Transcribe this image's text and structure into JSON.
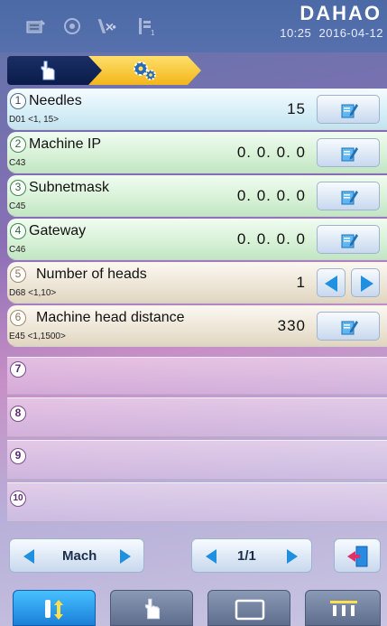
{
  "header": {
    "brand": "DAHAO",
    "time": "10:25",
    "date": "2016-04-12",
    "status_icons": [
      "card-reader-icon",
      "spool-icon",
      "needle-cut-icon",
      "head-count-icon"
    ]
  },
  "tabs": [
    {
      "name": "manual",
      "icon": "hand-pointer-icon"
    },
    {
      "name": "settings",
      "icon": "gears-icon",
      "active": true
    }
  ],
  "params": [
    {
      "num": "1",
      "label": "Needles",
      "code": "D01  <1, 15>",
      "value": "15",
      "control": "edit",
      "color": "blue"
    },
    {
      "num": "2",
      "label": "Machine IP",
      "code": "C43",
      "value": "0. 0. 0. 0",
      "control": "edit",
      "color": "green"
    },
    {
      "num": "3",
      "label": "Subnetmask",
      "code": "C45",
      "value": "0. 0. 0. 0",
      "control": "edit",
      "color": "green"
    },
    {
      "num": "4",
      "label": "Gateway",
      "code": "C46",
      "value": "0. 0. 0. 0",
      "control": "edit",
      "color": "green"
    },
    {
      "num": "5",
      "label": "Number of heads",
      "code": "D68  <1,10>",
      "value": "1",
      "control": "arrows",
      "color": "tan"
    },
    {
      "num": "6",
      "label": "Machine head distance",
      "code": "E45  <1,1500>",
      "value": "330",
      "control": "edit",
      "color": "tan"
    },
    {
      "num": "7",
      "label": "",
      "code": "",
      "value": "",
      "control": "none",
      "color": "empty"
    },
    {
      "num": "8",
      "label": "",
      "code": "",
      "value": "",
      "control": "none",
      "color": "empty"
    },
    {
      "num": "9",
      "label": "",
      "code": "",
      "value": "",
      "control": "none",
      "color": "empty"
    },
    {
      "num": "10",
      "label": "",
      "code": "",
      "value": "",
      "control": "none",
      "color": "empty"
    }
  ],
  "footer": {
    "category": "Mach",
    "page": "1/1",
    "exit_icon": "exit-door-icon"
  },
  "nav": [
    {
      "name": "needle-color",
      "icon": "needle-updown-icon",
      "active": true
    },
    {
      "name": "manual-op",
      "icon": "hand-pointer-icon"
    },
    {
      "name": "frame",
      "icon": "frame-rect-icon"
    },
    {
      "name": "needle-bar",
      "icon": "needle-bar-icon"
    }
  ],
  "colors": {
    "arrow_blue": "#1f8fe0",
    "active_tab": "#f3b51b",
    "exit_red": "#e0306a"
  }
}
